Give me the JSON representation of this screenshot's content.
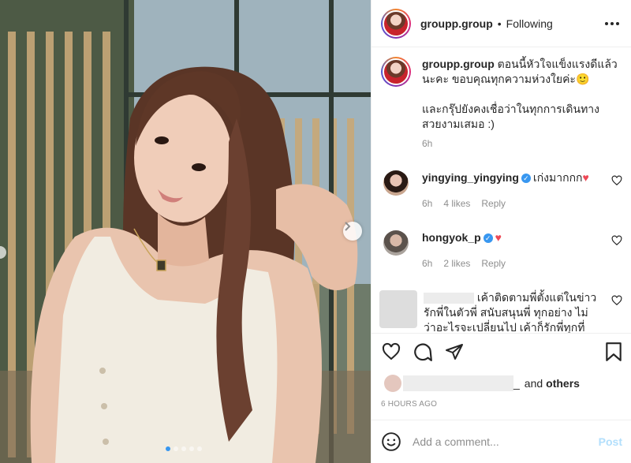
{
  "post": {
    "username": "groupp.group",
    "separator": "•",
    "follow_status": "Following",
    "more_icon": "more-options-icon"
  },
  "caption": {
    "username": "groupp.group",
    "text_1": "ตอนนี้หัวใจแข็งแรงดีแล้วนะคะ ขอบคุณทุกความห่วงใยค่ะ🙂",
    "text_2": "และกรุ๊ปยังคงเชื่อว่าในทุกการเดินทางสวยงามเสมอ :)",
    "time": "6h"
  },
  "comments": [
    {
      "username": "yingying_yingying",
      "text": "เก่งมากกก",
      "emoji": "♥",
      "time": "6h",
      "likes": "4 likes",
      "reply": "Reply"
    },
    {
      "username": "hongyok_p",
      "text": "",
      "emoji": "♥",
      "time": "6h",
      "likes": "2 likes",
      "reply": "Reply"
    },
    {
      "text": "เค้าติดตามพี่ตั้งแต่ในข่าว รักพี่ในตัวพี่ สนับสนุนพี่ ทุกอย่าง ไม่ว่าอะไรจะเปลี่ยนไป เค้าก็รักพี่ทุกที่เป็นพี่"
    }
  ],
  "likes": {
    "separator": "_",
    "and": "and",
    "others": "others"
  },
  "timestamp": "6 HOURS AGO",
  "add_comment": {
    "placeholder": "Add a comment...",
    "post": "Post"
  },
  "icons": [
    "heart-icon",
    "comment-icon",
    "share-icon",
    "bookmark-icon",
    "emoji-icon",
    "chevron-right-icon"
  ],
  "colors": {
    "link_blue": "#3897f0",
    "heart_red": "#ed4956",
    "muted": "#8e8e8e",
    "post_disabled": "#b2dffc"
  }
}
